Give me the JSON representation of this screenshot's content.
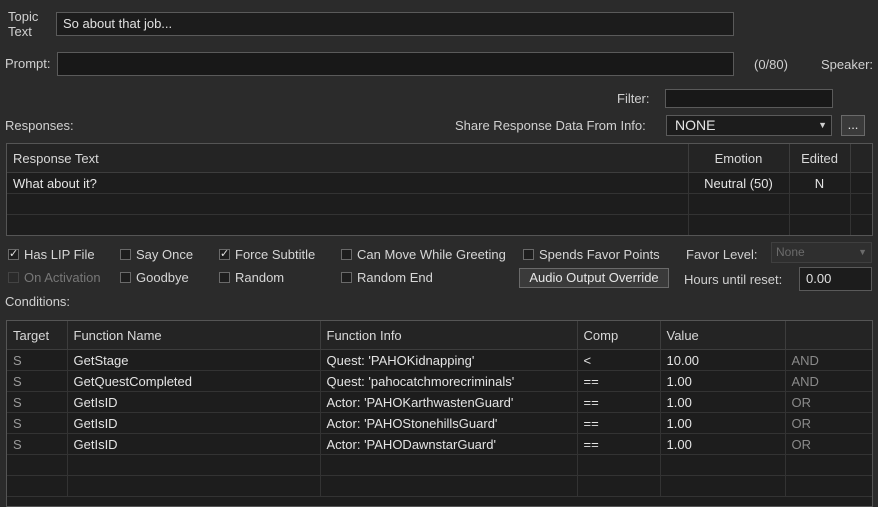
{
  "topic": {
    "label_line1": "Topic",
    "label_line2": "Text",
    "value": "So about that job..."
  },
  "prompt": {
    "label": "Prompt:",
    "value": "",
    "counter": "(0/80)",
    "speaker_label": "Speaker:"
  },
  "filter": {
    "label": "Filter:",
    "value": ""
  },
  "responses": {
    "label": "Responses:",
    "share_label": "Share Response Data From Info:",
    "share_value": "NONE",
    "more_button": "...",
    "columns": [
      "Response Text",
      "Emotion",
      "Edited"
    ],
    "rows": [
      {
        "text": "What about it?",
        "emotion": "Neutral (50)",
        "edited": "N"
      }
    ]
  },
  "flags": {
    "has_lip_file": {
      "label": "Has LIP File",
      "checked": true
    },
    "say_once": {
      "label": "Say Once",
      "checked": false
    },
    "force_subtitle": {
      "label": "Force Subtitle",
      "checked": true
    },
    "can_move_while_greeting": {
      "label": "Can Move While Greeting",
      "checked": false
    },
    "spends_favor_points": {
      "label": "Spends Favor Points",
      "checked": false
    },
    "on_activation": {
      "label": "On Activation",
      "checked": false
    },
    "goodbye": {
      "label": "Goodbye",
      "checked": false
    },
    "random": {
      "label": "Random",
      "checked": false
    },
    "random_end": {
      "label": "Random End",
      "checked": false
    }
  },
  "favor": {
    "label": "Favor Level:",
    "value": "None"
  },
  "audio_button": "Audio Output Override",
  "hours": {
    "label": "Hours until reset:",
    "value": "0.00"
  },
  "conditions": {
    "label": "Conditions:",
    "columns": [
      "Target",
      "Function Name",
      "Function Info",
      "Comp",
      "Value",
      ""
    ],
    "rows": [
      {
        "target": "S",
        "function": "GetStage",
        "info": "Quest: 'PAHOKidnapping'",
        "comp": "<",
        "value": "10.00",
        "op": "AND"
      },
      {
        "target": "S",
        "function": "GetQuestCompleted",
        "info": "Quest: 'pahocatchmorecriminals'",
        "comp": "==",
        "value": "1.00",
        "op": "AND"
      },
      {
        "target": "S",
        "function": "GetIsID",
        "info": "Actor: 'PAHOKarthwastenGuard'",
        "comp": "==",
        "value": "1.00",
        "op": "OR"
      },
      {
        "target": "S",
        "function": "GetIsID",
        "info": "Actor: 'PAHOStonehillsGuard'",
        "comp": "==",
        "value": "1.00",
        "op": "OR"
      },
      {
        "target": "S",
        "function": "GetIsID",
        "info": "Actor: 'PAHODawnstarGuard'",
        "comp": "==",
        "value": "1.00",
        "op": "OR"
      }
    ]
  }
}
